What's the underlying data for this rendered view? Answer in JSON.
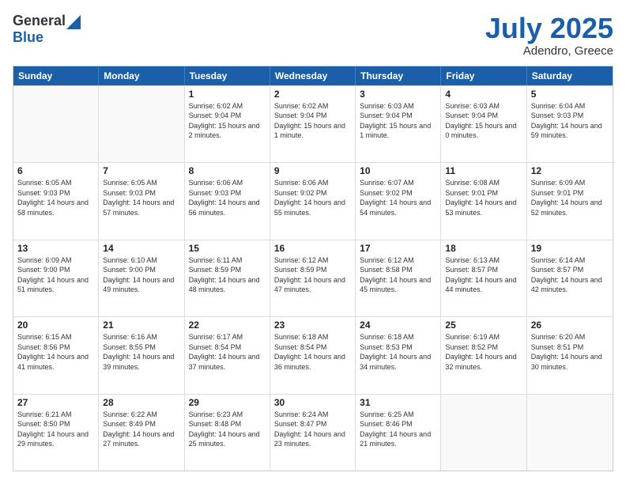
{
  "logo": {
    "general": "General",
    "blue": "Blue"
  },
  "title": "July 2025",
  "location": "Adendro, Greece",
  "days_of_week": [
    "Sunday",
    "Monday",
    "Tuesday",
    "Wednesday",
    "Thursday",
    "Friday",
    "Saturday"
  ],
  "weeks": [
    [
      {
        "day": "",
        "empty": true
      },
      {
        "day": "",
        "empty": true
      },
      {
        "day": "1",
        "sunrise": "Sunrise: 6:02 AM",
        "sunset": "Sunset: 9:04 PM",
        "daylight": "Daylight: 15 hours and 2 minutes."
      },
      {
        "day": "2",
        "sunrise": "Sunrise: 6:02 AM",
        "sunset": "Sunset: 9:04 PM",
        "daylight": "Daylight: 15 hours and 1 minute."
      },
      {
        "day": "3",
        "sunrise": "Sunrise: 6:03 AM",
        "sunset": "Sunset: 9:04 PM",
        "daylight": "Daylight: 15 hours and 1 minute."
      },
      {
        "day": "4",
        "sunrise": "Sunrise: 6:03 AM",
        "sunset": "Sunset: 9:04 PM",
        "daylight": "Daylight: 15 hours and 0 minutes."
      },
      {
        "day": "5",
        "sunrise": "Sunrise: 6:04 AM",
        "sunset": "Sunset: 9:03 PM",
        "daylight": "Daylight: 14 hours and 59 minutes."
      }
    ],
    [
      {
        "day": "6",
        "sunrise": "Sunrise: 6:05 AM",
        "sunset": "Sunset: 9:03 PM",
        "daylight": "Daylight: 14 hours and 58 minutes."
      },
      {
        "day": "7",
        "sunrise": "Sunrise: 6:05 AM",
        "sunset": "Sunset: 9:03 PM",
        "daylight": "Daylight: 14 hours and 57 minutes."
      },
      {
        "day": "8",
        "sunrise": "Sunrise: 6:06 AM",
        "sunset": "Sunset: 9:03 PM",
        "daylight": "Daylight: 14 hours and 56 minutes."
      },
      {
        "day": "9",
        "sunrise": "Sunrise: 6:06 AM",
        "sunset": "Sunset: 9:02 PM",
        "daylight": "Daylight: 14 hours and 55 minutes."
      },
      {
        "day": "10",
        "sunrise": "Sunrise: 6:07 AM",
        "sunset": "Sunset: 9:02 PM",
        "daylight": "Daylight: 14 hours and 54 minutes."
      },
      {
        "day": "11",
        "sunrise": "Sunrise: 6:08 AM",
        "sunset": "Sunset: 9:01 PM",
        "daylight": "Daylight: 14 hours and 53 minutes."
      },
      {
        "day": "12",
        "sunrise": "Sunrise: 6:09 AM",
        "sunset": "Sunset: 9:01 PM",
        "daylight": "Daylight: 14 hours and 52 minutes."
      }
    ],
    [
      {
        "day": "13",
        "sunrise": "Sunrise: 6:09 AM",
        "sunset": "Sunset: 9:00 PM",
        "daylight": "Daylight: 14 hours and 51 minutes."
      },
      {
        "day": "14",
        "sunrise": "Sunrise: 6:10 AM",
        "sunset": "Sunset: 9:00 PM",
        "daylight": "Daylight: 14 hours and 49 minutes."
      },
      {
        "day": "15",
        "sunrise": "Sunrise: 6:11 AM",
        "sunset": "Sunset: 8:59 PM",
        "daylight": "Daylight: 14 hours and 48 minutes."
      },
      {
        "day": "16",
        "sunrise": "Sunrise: 6:12 AM",
        "sunset": "Sunset: 8:59 PM",
        "daylight": "Daylight: 14 hours and 47 minutes."
      },
      {
        "day": "17",
        "sunrise": "Sunrise: 6:12 AM",
        "sunset": "Sunset: 8:58 PM",
        "daylight": "Daylight: 14 hours and 45 minutes."
      },
      {
        "day": "18",
        "sunrise": "Sunrise: 6:13 AM",
        "sunset": "Sunset: 8:57 PM",
        "daylight": "Daylight: 14 hours and 44 minutes."
      },
      {
        "day": "19",
        "sunrise": "Sunrise: 6:14 AM",
        "sunset": "Sunset: 8:57 PM",
        "daylight": "Daylight: 14 hours and 42 minutes."
      }
    ],
    [
      {
        "day": "20",
        "sunrise": "Sunrise: 6:15 AM",
        "sunset": "Sunset: 8:56 PM",
        "daylight": "Daylight: 14 hours and 41 minutes."
      },
      {
        "day": "21",
        "sunrise": "Sunrise: 6:16 AM",
        "sunset": "Sunset: 8:55 PM",
        "daylight": "Daylight: 14 hours and 39 minutes."
      },
      {
        "day": "22",
        "sunrise": "Sunrise: 6:17 AM",
        "sunset": "Sunset: 8:54 PM",
        "daylight": "Daylight: 14 hours and 37 minutes."
      },
      {
        "day": "23",
        "sunrise": "Sunrise: 6:18 AM",
        "sunset": "Sunset: 8:54 PM",
        "daylight": "Daylight: 14 hours and 36 minutes."
      },
      {
        "day": "24",
        "sunrise": "Sunrise: 6:18 AM",
        "sunset": "Sunset: 8:53 PM",
        "daylight": "Daylight: 14 hours and 34 minutes."
      },
      {
        "day": "25",
        "sunrise": "Sunrise: 6:19 AM",
        "sunset": "Sunset: 8:52 PM",
        "daylight": "Daylight: 14 hours and 32 minutes."
      },
      {
        "day": "26",
        "sunrise": "Sunrise: 6:20 AM",
        "sunset": "Sunset: 8:51 PM",
        "daylight": "Daylight: 14 hours and 30 minutes."
      }
    ],
    [
      {
        "day": "27",
        "sunrise": "Sunrise: 6:21 AM",
        "sunset": "Sunset: 8:50 PM",
        "daylight": "Daylight: 14 hours and 29 minutes."
      },
      {
        "day": "28",
        "sunrise": "Sunrise: 6:22 AM",
        "sunset": "Sunset: 8:49 PM",
        "daylight": "Daylight: 14 hours and 27 minutes."
      },
      {
        "day": "29",
        "sunrise": "Sunrise: 6:23 AM",
        "sunset": "Sunset: 8:48 PM",
        "daylight": "Daylight: 14 hours and 25 minutes."
      },
      {
        "day": "30",
        "sunrise": "Sunrise: 6:24 AM",
        "sunset": "Sunset: 8:47 PM",
        "daylight": "Daylight: 14 hours and 23 minutes."
      },
      {
        "day": "31",
        "sunrise": "Sunrise: 6:25 AM",
        "sunset": "Sunset: 8:46 PM",
        "daylight": "Daylight: 14 hours and 21 minutes."
      },
      {
        "day": "",
        "empty": true
      },
      {
        "day": "",
        "empty": true
      }
    ]
  ]
}
